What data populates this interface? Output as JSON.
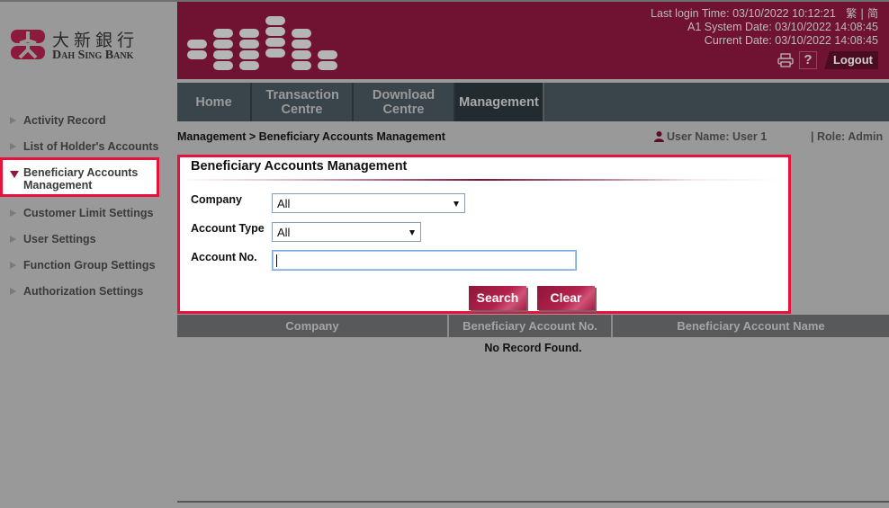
{
  "brand": {
    "name_cn": "大新銀行",
    "name_en": "Dah Sing Bank",
    "primary_color": "#701332",
    "accent_color": "#e8113c"
  },
  "header": {
    "last_login": "Last login Time: 03/10/2022 10:12:21",
    "lang_traditional": "繁",
    "lang_separator": "|",
    "lang_simplified": "简",
    "system_date": "A1 System Date: 03/10/2022 14:08:45",
    "current_date": "Current Date: 03/10/2022 14:08:45",
    "print_icon": "printer-icon",
    "help_label": "?",
    "logout_label": "Logout"
  },
  "nav": {
    "tabs": [
      {
        "label": "Home",
        "active": false
      },
      {
        "label": "Transaction Centre",
        "active": false
      },
      {
        "label": "Download Centre",
        "active": false
      },
      {
        "label": "Management",
        "active": true
      }
    ]
  },
  "breadcrumb": "Management > Beneficiary Accounts Management",
  "user": {
    "name": "User Name: User 1",
    "role": "| Role: Admin"
  },
  "sidebar": {
    "items": [
      {
        "label": "Activity Record",
        "active": false
      },
      {
        "label": "List of Holder's Accounts",
        "active": false
      },
      {
        "label": "Beneficiary Accounts Management",
        "active": true
      },
      {
        "label": "Customer Limit Settings",
        "active": false
      },
      {
        "label": "User Settings",
        "active": false
      },
      {
        "label": "Function Group Settings",
        "active": false
      },
      {
        "label": "Authorization Settings",
        "active": false
      }
    ]
  },
  "form": {
    "title": "Beneficiary Accounts Management",
    "company_label": "Company",
    "company_value": "All",
    "account_type_label": "Account Type",
    "account_type_value": "All",
    "account_no_label": "Account No.",
    "account_no_value": "",
    "search_label": "Search",
    "clear_label": "Clear"
  },
  "results": {
    "columns": [
      "Company",
      "Beneficiary Account No.",
      "Beneficiary Account Name"
    ],
    "empty_message": "No Record Found."
  }
}
